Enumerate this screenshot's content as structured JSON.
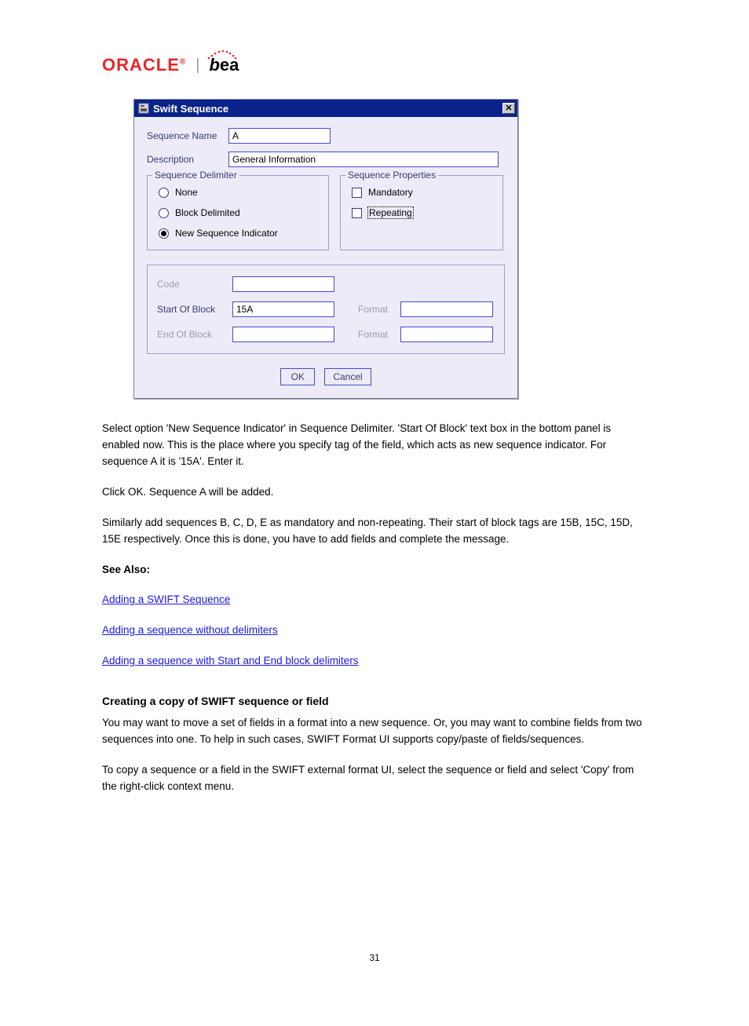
{
  "logo": {
    "oracle": "ORACLE",
    "reg": "®",
    "sep": "|",
    "bea": "bea"
  },
  "dialog": {
    "title": "Swift Sequence",
    "close_glyph": "✕",
    "sequence_name_label": "Sequence Name",
    "sequence_name_value": "A",
    "description_label": "Description",
    "description_value": "General Information",
    "delimiter": {
      "legend": "Sequence Delimiter",
      "none": "None",
      "block": "Block Delimited",
      "newseq": "New Sequence Indicator"
    },
    "properties": {
      "legend": "Sequence Properties",
      "mandatory": "Mandatory",
      "repeating": "Repeating"
    },
    "block": {
      "code_label": "Code",
      "code_value": "",
      "start_label": "Start Of Block",
      "start_value": "15A",
      "end_label": "End Of Block",
      "end_value": "",
      "format_label": "Format"
    },
    "buttons": {
      "ok": "OK",
      "cancel": "Cancel"
    }
  },
  "text": {
    "p1": "Select option 'New Sequence Indicator' in Sequence Delimiter. 'Start Of Block' text box in the bottom panel is enabled now. This is the place where you specify tag of the field, which acts as new sequence indicator. For sequence A it is '15A'. Enter it.",
    "p2": "Click OK. Sequence A will be added.",
    "p3": "Similarly add sequences B, C, D, E as mandatory and non-repeating. Their start of block tags are 15B, 15C, 15D, 15E respectively. Once this is done, you have to add fields and complete the message.",
    "see_also_heading": "See Also:",
    "links": [
      "Adding a SWIFT Sequence",
      "Adding a sequence without delimiters",
      "Adding a sequence with Start and End block delimiters"
    ],
    "heading": "Creating a copy of SWIFT sequence or field",
    "p4": "You may want to move a set of fields in a format into a new sequence. Or, you may want to combine fields from two sequences into one. To help in such cases, SWIFT Format UI supports copy/paste of fields/sequences.",
    "p5": "To copy a sequence or a field in the SWIFT external format UI, select the sequence or field and select 'Copy' from the right-click context menu."
  },
  "footer": "31"
}
